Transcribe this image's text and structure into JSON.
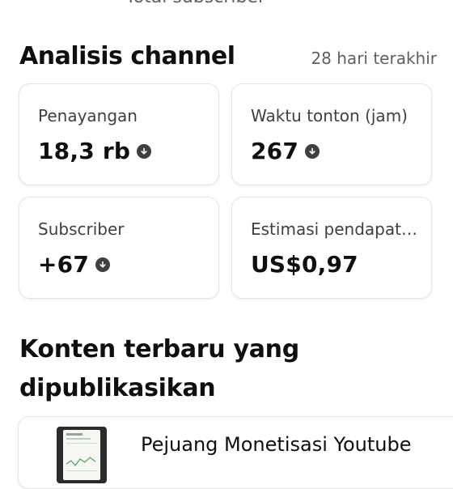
{
  "header": {
    "caption": "Total subscriber"
  },
  "analytics": {
    "title": "Analisis channel",
    "range": "28 hari terakhir",
    "cards": [
      {
        "label": "Penayangan",
        "value": "18,3 rb",
        "trend_icon": "arrow-down-circle-icon"
      },
      {
        "label": "Waktu tonton (jam)",
        "value": "267",
        "trend_icon": "arrow-down-circle-icon"
      },
      {
        "label": "Subscriber",
        "value": "+67",
        "trend_icon": "arrow-down-circle-icon"
      },
      {
        "label": "Estimasi pendapatan",
        "value": "US$0,97"
      }
    ]
  },
  "recent": {
    "title": "Konten terbaru yang dipublikasikan",
    "video": {
      "title": "Pejuang Monetisasi Youtube"
    }
  },
  "colors": {
    "text": "#0f0f0f",
    "secondary": "#606060",
    "border": "#e5e5e5",
    "icon": "#404040"
  }
}
